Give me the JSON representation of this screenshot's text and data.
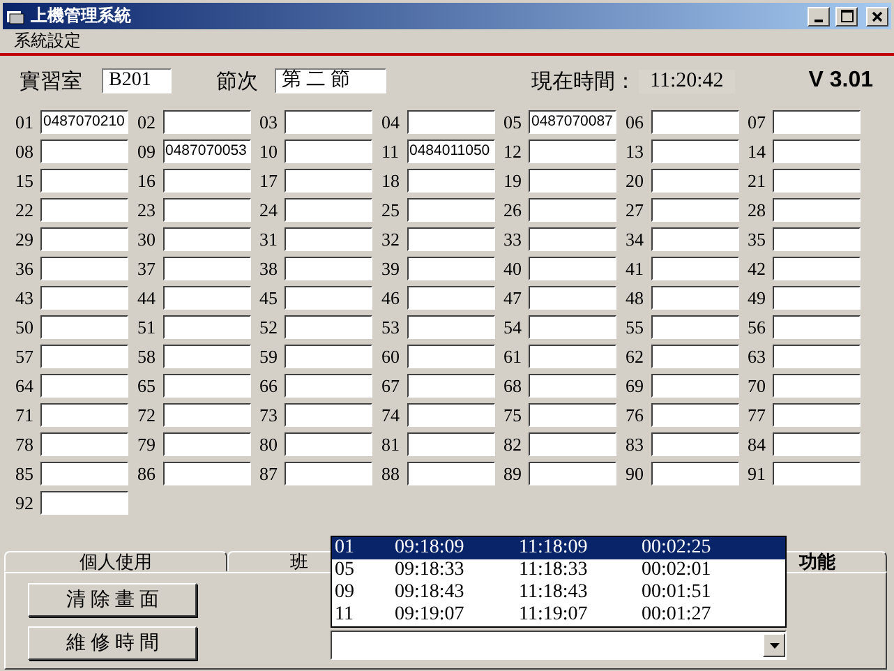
{
  "window": {
    "title": "上機管理系統"
  },
  "menu": [
    "系統設定"
  ],
  "header": {
    "room_label": "實習室",
    "room": "B201",
    "period_label": "節次",
    "period": "第 二 節",
    "time_label": "現在時間：",
    "time": "11:20:42",
    "version": "V 3.01"
  },
  "seats": [
    {
      "number": "01",
      "value": "0487070210"
    },
    {
      "number": "02"
    },
    {
      "number": "03"
    },
    {
      "number": "04"
    },
    {
      "number": "05",
      "value": "0487070087"
    },
    {
      "number": "06"
    },
    {
      "number": "07"
    },
    {
      "number": "08"
    },
    {
      "number": "09",
      "value": "0487070053"
    },
    {
      "number": "10"
    },
    {
      "number": "11",
      "value": "0484011050"
    },
    {
      "number": "12"
    },
    {
      "number": "13"
    },
    {
      "number": "14"
    },
    {
      "number": "15"
    },
    {
      "number": "16"
    },
    {
      "number": "17"
    },
    {
      "number": "18"
    },
    {
      "number": "19"
    },
    {
      "number": "20"
    },
    {
      "number": "21"
    },
    {
      "number": "22"
    },
    {
      "number": "23"
    },
    {
      "number": "24"
    },
    {
      "number": "25"
    },
    {
      "number": "26"
    },
    {
      "number": "27"
    },
    {
      "number": "28"
    },
    {
      "number": "29"
    },
    {
      "number": "30"
    },
    {
      "number": "31"
    },
    {
      "number": "32"
    },
    {
      "number": "33"
    },
    {
      "number": "34"
    },
    {
      "number": "35"
    },
    {
      "number": "36"
    },
    {
      "number": "37"
    },
    {
      "number": "38"
    },
    {
      "number": "39"
    },
    {
      "number": "40"
    },
    {
      "number": "41"
    },
    {
      "number": "42"
    },
    {
      "number": "43"
    },
    {
      "number": "44"
    },
    {
      "number": "45"
    },
    {
      "number": "46"
    },
    {
      "number": "47"
    },
    {
      "number": "48"
    },
    {
      "number": "49"
    },
    {
      "number": "50"
    },
    {
      "number": "51"
    },
    {
      "number": "52"
    },
    {
      "number": "53"
    },
    {
      "number": "54"
    },
    {
      "number": "55"
    },
    {
      "number": "56"
    },
    {
      "number": "57"
    },
    {
      "number": "58"
    },
    {
      "number": "59"
    },
    {
      "number": "60"
    },
    {
      "number": "61"
    },
    {
      "number": "62"
    },
    {
      "number": "63"
    },
    {
      "number": "64"
    },
    {
      "number": "65"
    },
    {
      "number": "66"
    },
    {
      "number": "67"
    },
    {
      "number": "68"
    },
    {
      "number": "69"
    },
    {
      "number": "70"
    },
    {
      "number": "71"
    },
    {
      "number": "72"
    },
    {
      "number": "73"
    },
    {
      "number": "74"
    },
    {
      "number": "75"
    },
    {
      "number": "76"
    },
    {
      "number": "77"
    },
    {
      "number": "78"
    },
    {
      "number": "79"
    },
    {
      "number": "80"
    },
    {
      "number": "81"
    },
    {
      "number": "82"
    },
    {
      "number": "83"
    },
    {
      "number": "84"
    },
    {
      "number": "85"
    },
    {
      "number": "86"
    },
    {
      "number": "87"
    },
    {
      "number": "88"
    },
    {
      "number": "89"
    },
    {
      "number": "90"
    },
    {
      "number": "91"
    },
    {
      "number": "92"
    }
  ],
  "tabs": [
    {
      "label": "個人使用",
      "selected": false
    },
    {
      "label": "班",
      "selected": false
    },
    {
      "label": "功能",
      "selected": true
    }
  ],
  "buttons": [
    "清 除 畫 面",
    "維 修 時 間"
  ],
  "dropdown": {
    "rows": [
      {
        "cells": [
          "01",
          "09:18:09",
          "11:18:09",
          "00:02:25"
        ],
        "selected": true
      },
      {
        "cells": [
          "05",
          "09:18:33",
          "11:18:33",
          "00:02:01"
        ],
        "selected": false
      },
      {
        "cells": [
          "09",
          "09:18:43",
          "11:18:43",
          "00:01:51"
        ],
        "selected": false
      },
      {
        "cells": [
          "11",
          "09:19:07",
          "11:19:07",
          "00:01:27"
        ],
        "selected": false
      }
    ]
  }
}
